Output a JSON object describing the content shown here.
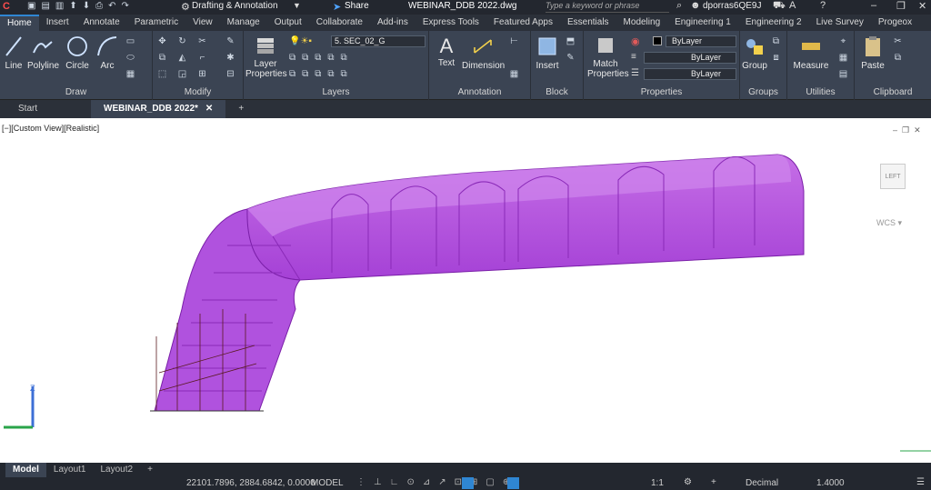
{
  "titlebar": {
    "workspace": "Drafting & Annotation",
    "share_label": "Share",
    "document_title": "WEBINAR_DDB 2022.dwg",
    "search_placeholder": "Type a keyword or phrase",
    "user": "dporras6QE9J"
  },
  "menu": {
    "tabs": [
      "Home",
      "Insert",
      "Annotate",
      "Parametric",
      "View",
      "Manage",
      "Output",
      "Collaborate",
      "Add-ins",
      "Express Tools",
      "Featured Apps",
      "Essentials",
      "Modeling",
      "Engineering 1",
      "Engineering 2",
      "Live Survey",
      "Progeox"
    ],
    "active": "Home"
  },
  "ribbon": {
    "draw": {
      "title": "Draw",
      "line": "Line",
      "polyline": "Polyline",
      "circle": "Circle",
      "arc": "Arc"
    },
    "modify": {
      "title": "Modify"
    },
    "layers": {
      "title": "Layers",
      "layer_properties": "Layer Properties",
      "current_layer": "5. SEC_02_G"
    },
    "annotation": {
      "title": "Annotation",
      "text": "Text",
      "dimension": "Dimension"
    },
    "block": {
      "title": "Block",
      "insert": "Insert"
    },
    "properties": {
      "title": "Properties",
      "match": "Match Properties",
      "color": "ByLayer",
      "linetype": "ByLayer",
      "lineweight": "ByLayer"
    },
    "groups": {
      "title": "Groups",
      "group": "Group"
    },
    "utilities": {
      "title": "Utilities",
      "measure": "Measure"
    },
    "clipboard": {
      "title": "Clipboard",
      "paste": "Paste"
    }
  },
  "file_tabs": {
    "start": "Start",
    "active": "WEBINAR_DDB 2022*"
  },
  "viewport": {
    "label": "[−][Custom View][Realistic]",
    "viewcube_face": "LEFT",
    "wcs": "WCS"
  },
  "layout_tabs": {
    "model": "Model",
    "layout1": "Layout1",
    "layout2": "Layout2"
  },
  "status": {
    "coords": "22101.7896, 2884.6842, 0.0000",
    "space": "MODEL",
    "scale": "1:1",
    "units": "Decimal",
    "value": "1.4000"
  },
  "colors": {
    "accent": "#2f86d3",
    "tunnel": "#b452e0",
    "tunnel_edge": "#7a1fa8"
  }
}
